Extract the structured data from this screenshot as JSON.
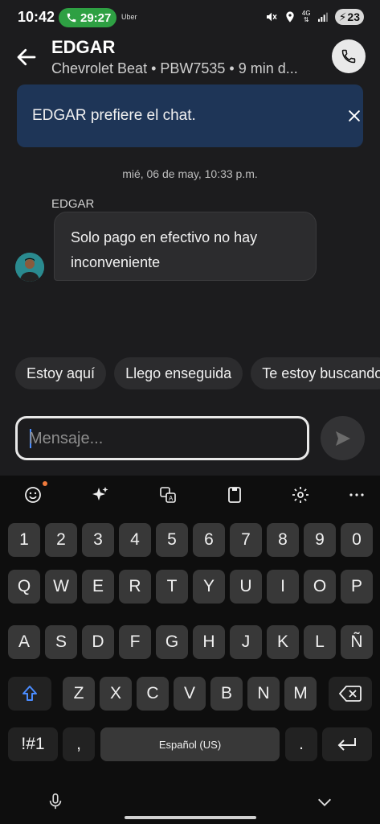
{
  "status_bar": {
    "time": "10:42",
    "call_timer": "29:27",
    "app_label": "Uber",
    "network": "4G",
    "battery": "23"
  },
  "header": {
    "driver_name": "EDGAR",
    "subtitle": "Chevrolet Beat • PBW7535 • 9 min d..."
  },
  "banner": {
    "text": "EDGAR prefiere el chat."
  },
  "chat": {
    "timestamp": "mié, 06 de may, 10:33 p.m.",
    "sender": "EDGAR",
    "message_line1": "Solo pago en efectivo no hay",
    "message_line2": "inconveniente"
  },
  "quick_replies": [
    "Estoy aquí",
    "Llego enseguida",
    "Te estoy buscando"
  ],
  "composer": {
    "placeholder": "Mensaje..."
  },
  "keyboard": {
    "numbers": [
      "1",
      "2",
      "3",
      "4",
      "5",
      "6",
      "7",
      "8",
      "9",
      "0"
    ],
    "row1": [
      "Q",
      "W",
      "E",
      "R",
      "T",
      "Y",
      "U",
      "I",
      "O",
      "P"
    ],
    "row2": [
      "A",
      "S",
      "D",
      "F",
      "G",
      "H",
      "J",
      "K",
      "L",
      "Ñ"
    ],
    "row3": [
      "Z",
      "X",
      "C",
      "V",
      "B",
      "N",
      "M"
    ],
    "symbols_key": "!#1",
    "comma_key": ",",
    "space_label": "Español (US)",
    "period_key": ".",
    "toolbar_icons": [
      "emoji-icon",
      "sparkle-icon",
      "translate-icon",
      "clipboard-icon",
      "settings-icon",
      "more-icon"
    ]
  },
  "colors": {
    "background": "#1c1c1e",
    "banner": "#1e3557",
    "call_pill": "#2ea043",
    "key": "#383838",
    "shift_accent": "#4a8cff"
  }
}
